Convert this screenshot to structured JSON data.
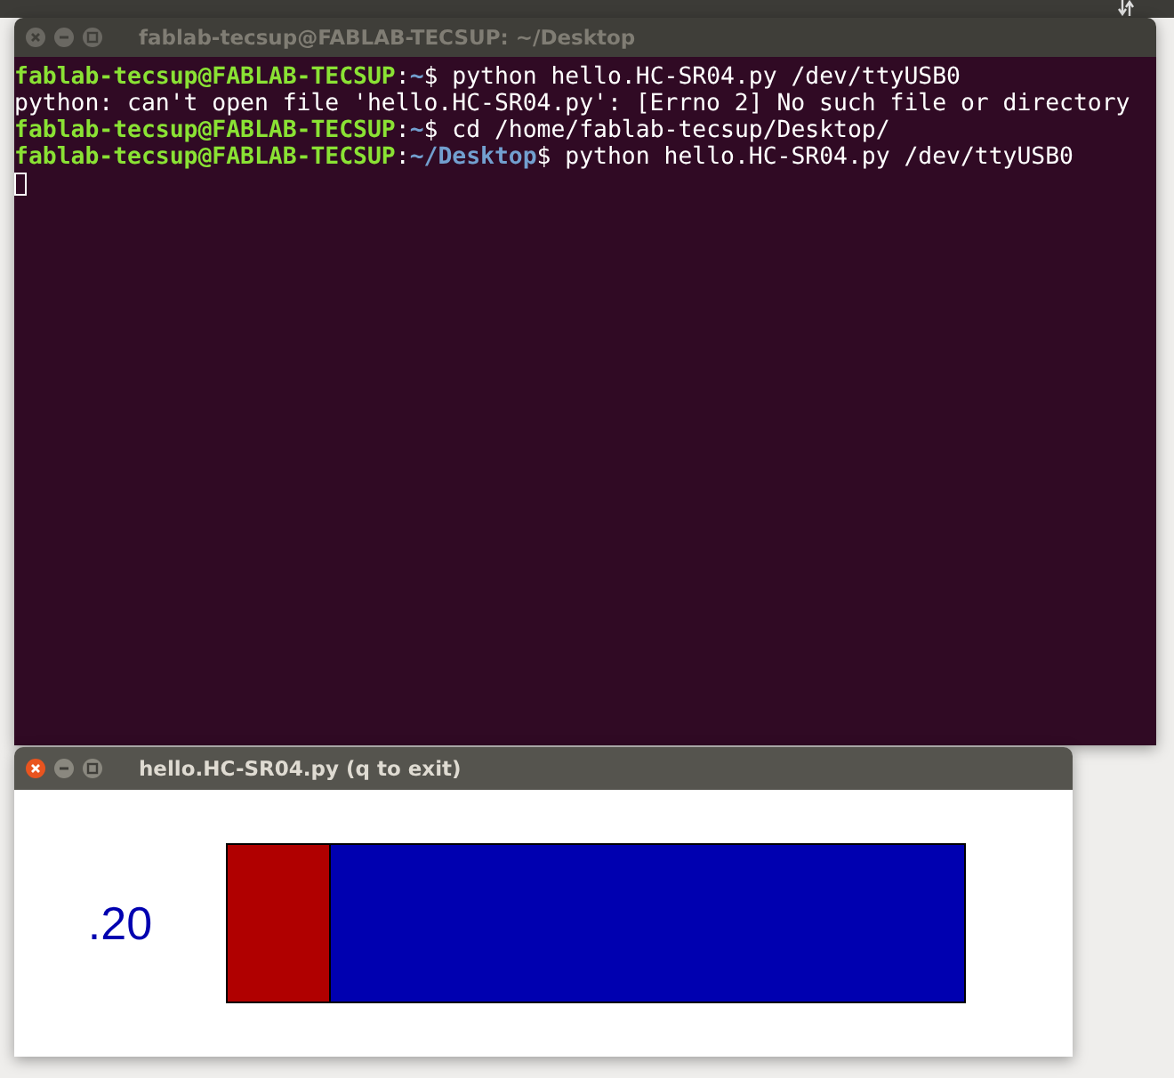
{
  "terminal": {
    "title": "fablab-tecsup@FABLAB-TECSUP: ~/Desktop",
    "active": false,
    "lines": [
      {
        "kind": "prompt",
        "user": "fablab-tecsup@FABLAB-TECSUP",
        "colon": ":",
        "path": "~",
        "command": "$ python hello.HC-SR04.py /dev/ttyUSB0"
      },
      {
        "kind": "output",
        "text": "python: can't open file 'hello.HC-SR04.py': [Errno 2] No such file or directory"
      },
      {
        "kind": "prompt",
        "user": "fablab-tecsup@FABLAB-TECSUP",
        "colon": ":",
        "path": "~",
        "command": "$ cd /home/fablab-tecsup/Desktop/"
      },
      {
        "kind": "prompt",
        "user": "fablab-tecsup@FABLAB-TECSUP",
        "colon": ":",
        "path": "~/Desktop",
        "command": "$ python hello.HC-SR04.py /dev/ttyUSB0"
      },
      {
        "kind": "cursor"
      }
    ]
  },
  "sensor_window": {
    "title": "hello.HC-SR04.py (q to exit)",
    "active": true,
    "reading": ".20",
    "level": 0.14
  }
}
